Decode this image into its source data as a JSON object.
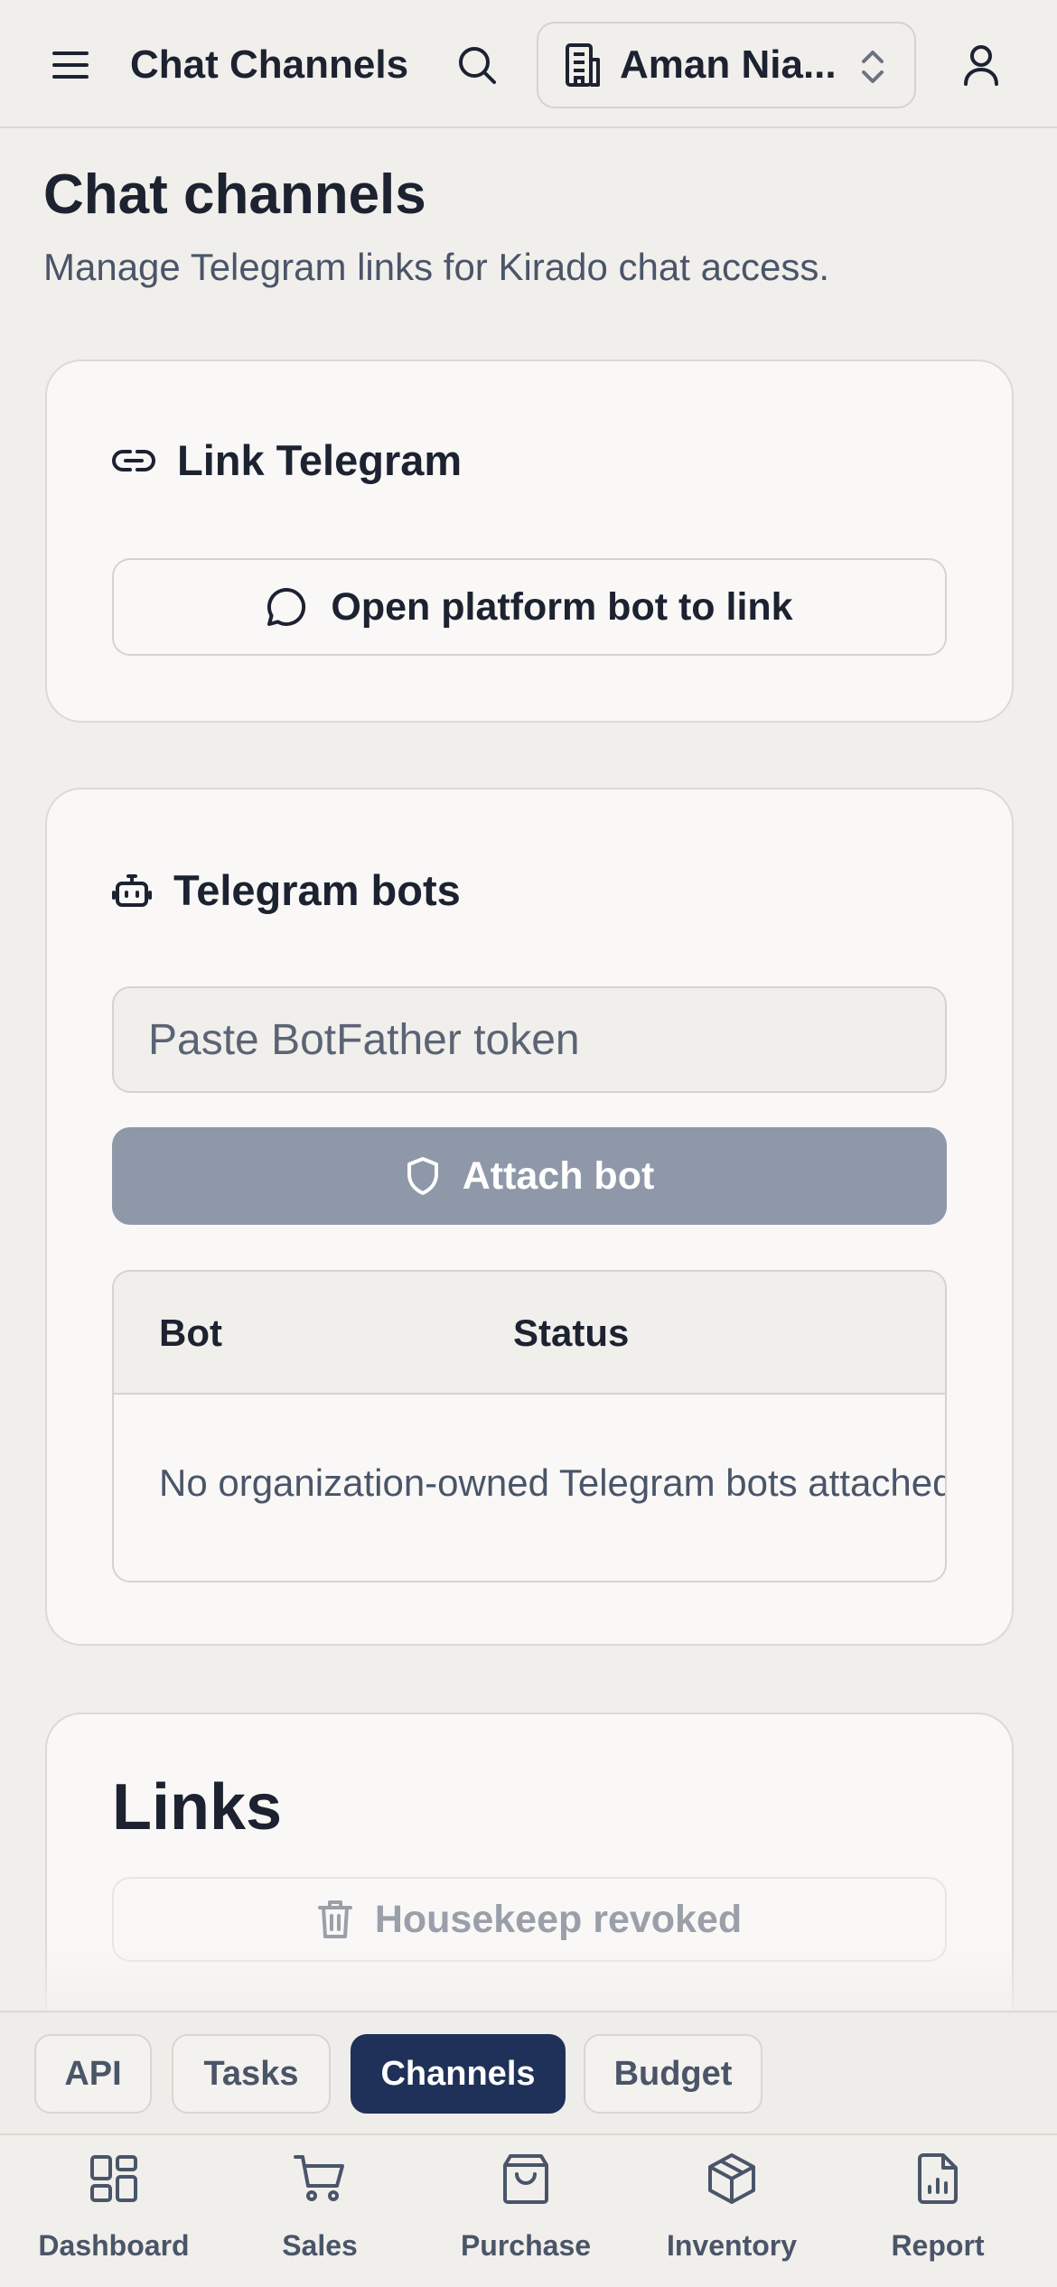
{
  "topbar": {
    "title": "Chat Channels",
    "org_name": "Aman Nia...",
    "icons": [
      "menu-icon",
      "search-icon",
      "building-icon",
      "chevrons-up-down-icon",
      "user-icon"
    ]
  },
  "header": {
    "title": "Chat channels",
    "subtitle": "Manage Telegram links for Kirado chat access."
  },
  "link_card": {
    "heading": "Link Telegram",
    "heading_icon": "link-icon",
    "open_bot_label": "Open platform bot to link",
    "open_bot_icon": "message-circle-icon"
  },
  "bots_card": {
    "heading": "Telegram bots",
    "heading_icon": "bot-icon",
    "token_placeholder": "Paste BotFather token",
    "token_value": "",
    "attach_label": "Attach bot",
    "attach_icon": "shield-icon",
    "table": {
      "columns": [
        "Bot",
        "Status"
      ],
      "empty_text": "No organization-owned Telegram bots attached yet."
    }
  },
  "links_card": {
    "heading": "Links",
    "housekeep_label": "Housekeep revoked",
    "housekeep_icon": "trash-icon"
  },
  "tabs": [
    {
      "label": "API",
      "active": false
    },
    {
      "label": "Tasks",
      "active": false
    },
    {
      "label": "Channels",
      "active": true
    },
    {
      "label": "Budget",
      "active": false
    }
  ],
  "bottom_nav": [
    {
      "label": "Dashboard",
      "icon": "dashboard-icon"
    },
    {
      "label": "Sales",
      "icon": "cart-icon"
    },
    {
      "label": "Purchase",
      "icon": "shopping-bag-icon"
    },
    {
      "label": "Inventory",
      "icon": "package-icon"
    },
    {
      "label": "Report",
      "icon": "report-icon"
    }
  ],
  "colors": {
    "background": "#f1efec",
    "card": "#f9f8f7",
    "accent": "#1f3158",
    "attach_button": "#8e98a8",
    "text": "#1c2230",
    "muted_text": "#4a5568"
  }
}
